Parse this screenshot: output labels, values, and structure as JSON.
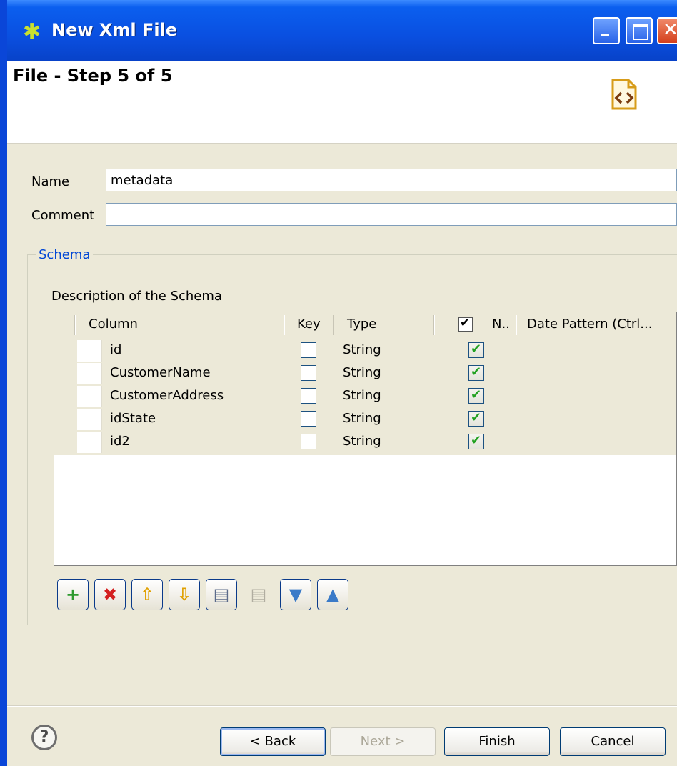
{
  "window": {
    "title": "New Xml File"
  },
  "header": {
    "step_title": "File - Step 5 of 5"
  },
  "form": {
    "name_label": "Name",
    "name_value": "metadata",
    "comment_label": "Comment",
    "comment_value": ""
  },
  "schema": {
    "legend": "Schema",
    "description": "Description of the Schema",
    "columns": [
      "Column",
      "Key",
      "Type",
      "N..",
      "Date Pattern (Ctrl..."
    ],
    "rows": [
      {
        "column": "id",
        "key": false,
        "type": "String",
        "nullable": true
      },
      {
        "column": "CustomerName",
        "key": false,
        "type": "String",
        "nullable": true
      },
      {
        "column": "CustomerAddress",
        "key": false,
        "type": "String",
        "nullable": true
      },
      {
        "column": "idState",
        "key": false,
        "type": "String",
        "nullable": true
      },
      {
        "column": "id2",
        "key": false,
        "type": "String",
        "nullable": true
      }
    ]
  },
  "toolbar": [
    {
      "name": "add-icon",
      "glyph": "+",
      "color": "#2e9a2e",
      "enabled": true
    },
    {
      "name": "delete-icon",
      "glyph": "✖",
      "color": "#d42020",
      "enabled": true
    },
    {
      "name": "move-up-icon",
      "glyph": "⇧",
      "color": "#e0a000",
      "enabled": true
    },
    {
      "name": "move-down-icon",
      "glyph": "⇩",
      "color": "#e0a000",
      "enabled": true
    },
    {
      "name": "copy-icon",
      "glyph": "▤",
      "color": "#5a6a8a",
      "enabled": true
    },
    {
      "name": "paste-icon",
      "glyph": "▤",
      "color": "#b0ada0",
      "enabled": false
    },
    {
      "name": "import-icon",
      "glyph": "▼",
      "color": "#3a7ac8",
      "enabled": true
    },
    {
      "name": "export-icon",
      "glyph": "▲",
      "color": "#3a7ac8",
      "enabled": true
    }
  ],
  "buttons": {
    "back": "< Back",
    "next": "Next >",
    "finish": "Finish",
    "cancel": "Cancel"
  },
  "help_glyph": "?"
}
